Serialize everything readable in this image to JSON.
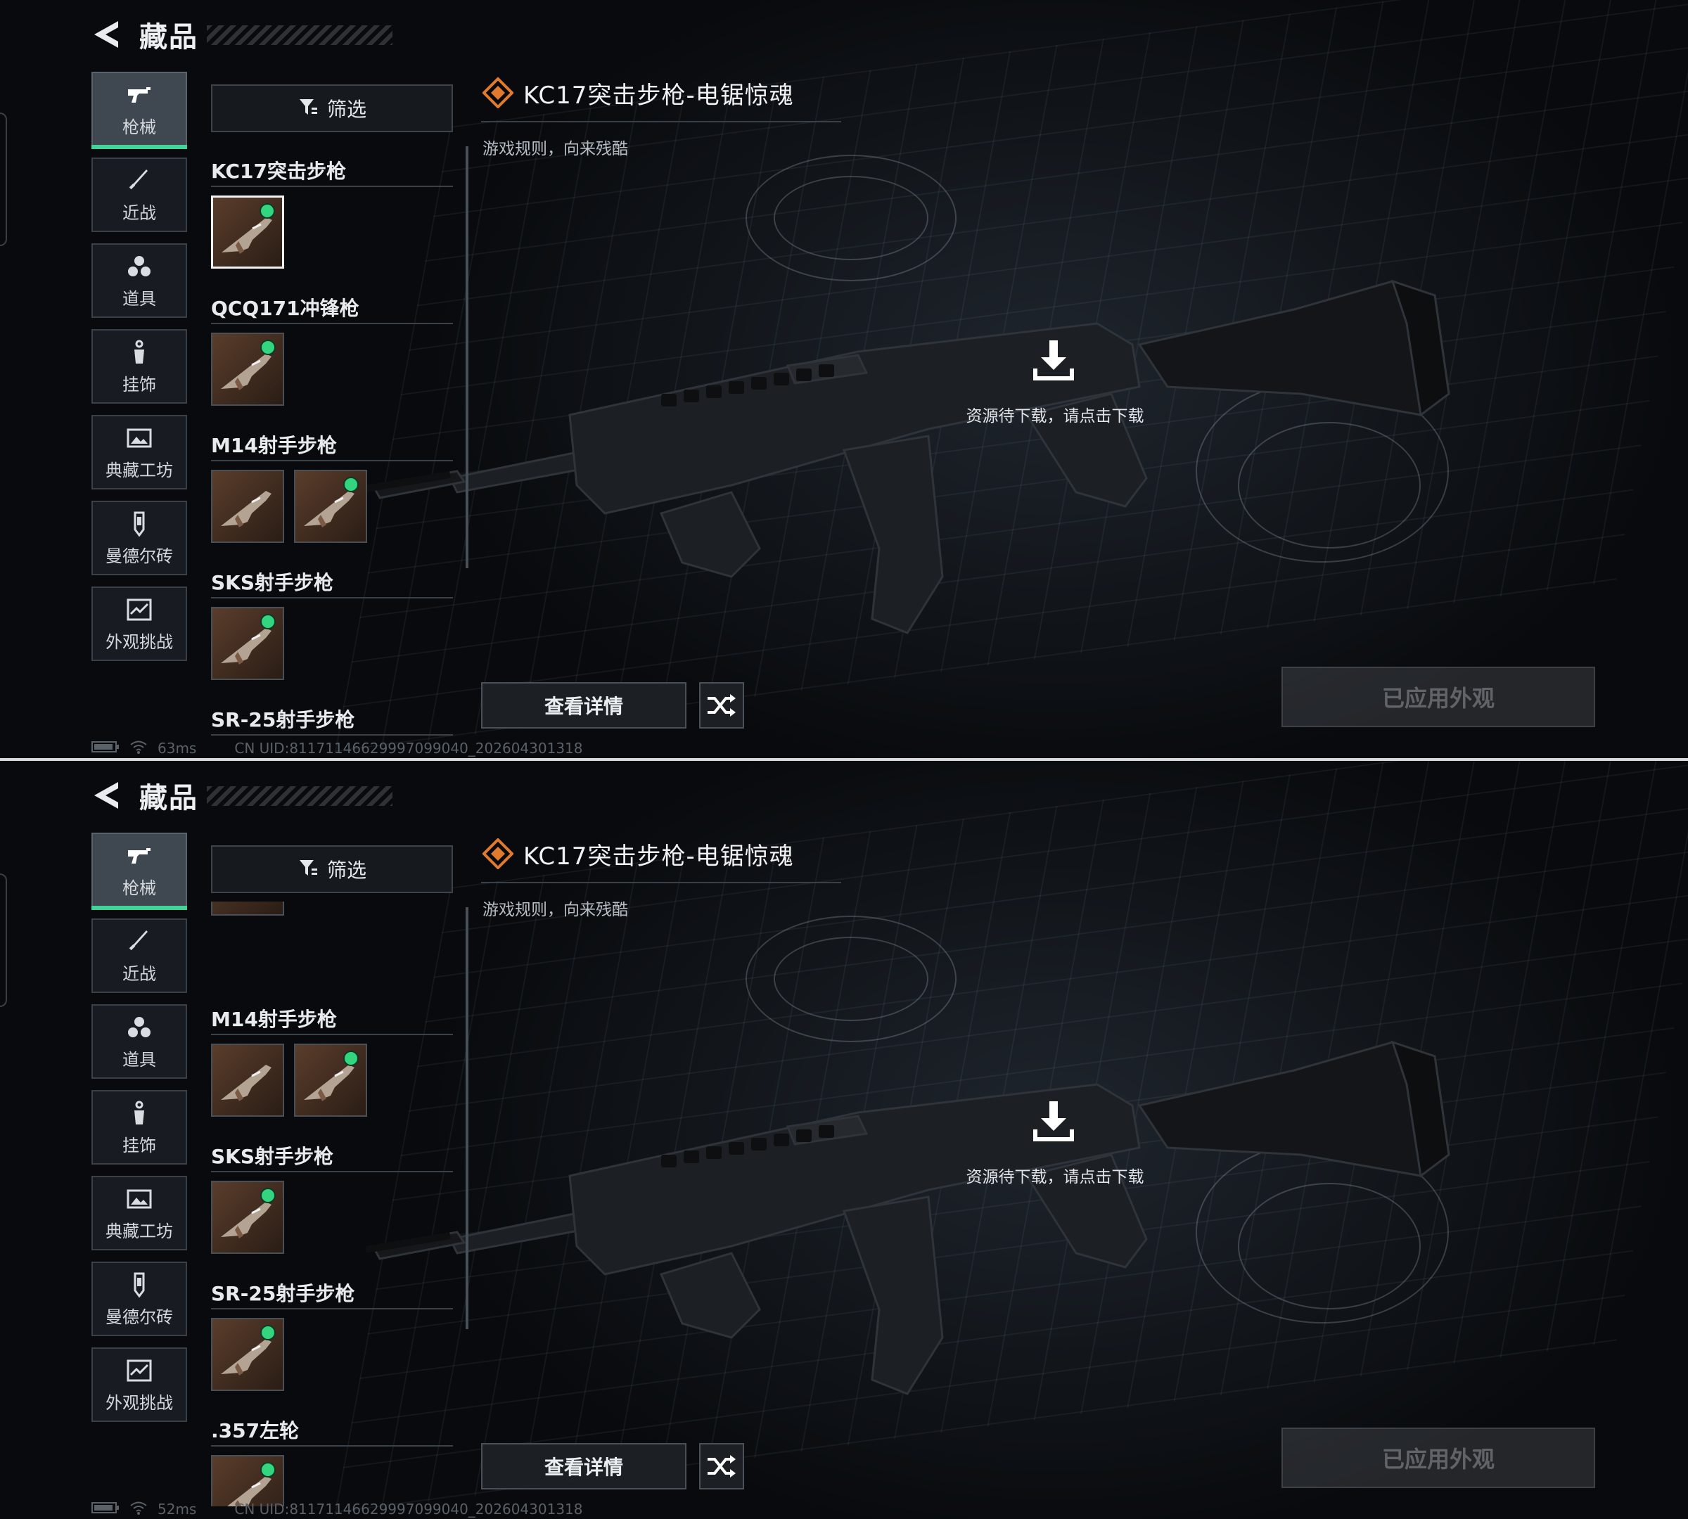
{
  "panels": [
    {
      "header": {
        "title": "藏品"
      },
      "categories": [
        {
          "label": "枪械",
          "icon": "gun-icon",
          "active": true
        },
        {
          "label": "近战",
          "icon": "knife-icon"
        },
        {
          "label": "道具",
          "icon": "grenades-icon"
        },
        {
          "label": "挂饰",
          "icon": "charm-icon"
        },
        {
          "label": "典藏工坊",
          "icon": "gallery-icon"
        },
        {
          "label": "曼德尔砖",
          "icon": "brick-icon"
        },
        {
          "label": "外观挑战",
          "icon": "challenge-icon"
        }
      ],
      "filter_label": "筛选",
      "groups": [
        {
          "name": "KC17突击步枪",
          "skins": [
            {
              "equipped": true,
              "selected": true
            }
          ]
        },
        {
          "name": "QCQ171冲锋枪",
          "skins": [
            {
              "equipped": true
            }
          ]
        },
        {
          "name": "M14射手步枪",
          "skins": [
            {
              "equipped": false
            },
            {
              "equipped": true
            }
          ]
        },
        {
          "name": "SKS射手步枪",
          "skins": [
            {
              "equipped": true
            }
          ]
        },
        {
          "name": "SR-25射手步枪",
          "skins": []
        }
      ],
      "skin": {
        "name": "KC17突击步枪-电锯惊魂",
        "subtitle": "游戏规则，向来残酷"
      },
      "download_hint": "资源待下载，请点击下载",
      "details_label": "查看详情",
      "applied_label": "已应用外观",
      "status": {
        "ping": "63ms",
        "uid": "CN UID:81171146629997099040_202604301318"
      }
    },
    {
      "header": {
        "title": "藏品"
      },
      "categories": [
        {
          "label": "枪械",
          "icon": "gun-icon",
          "active": true
        },
        {
          "label": "近战",
          "icon": "knife-icon"
        },
        {
          "label": "道具",
          "icon": "grenades-icon"
        },
        {
          "label": "挂饰",
          "icon": "charm-icon"
        },
        {
          "label": "典藏工坊",
          "icon": "gallery-icon"
        },
        {
          "label": "曼德尔砖",
          "icon": "brick-icon"
        },
        {
          "label": "外观挑战",
          "icon": "challenge-icon"
        }
      ],
      "filter_label": "筛选",
      "groups": [
        {
          "name": "M14射手步枪",
          "skins": [
            {
              "equipped": false
            },
            {
              "equipped": true
            }
          ]
        },
        {
          "name": "SKS射手步枪",
          "skins": [
            {
              "equipped": true
            }
          ]
        },
        {
          "name": "SR-25射手步枪",
          "skins": [
            {
              "equipped": true
            }
          ]
        },
        {
          "name": ".357左轮",
          "skins": [
            {
              "equipped": true
            }
          ]
        }
      ],
      "skin": {
        "name": "KC17突击步枪-电锯惊魂",
        "subtitle": "游戏规则，向来残酷"
      },
      "download_hint": "资源待下载，请点击下载",
      "details_label": "查看详情",
      "applied_label": "已应用外观",
      "status": {
        "ping": "52ms",
        "uid": "CN UID:81171146629997099040_202604301318"
      }
    }
  ],
  "colors": {
    "accent_green": "#41d49a",
    "equipped_dot": "#33d67f",
    "skin_orange": "#e07a2e"
  }
}
